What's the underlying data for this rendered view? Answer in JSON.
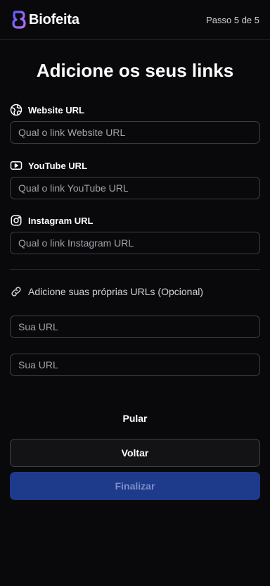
{
  "header": {
    "brand": "Biofeita",
    "step": "Passo 5 de 5"
  },
  "title": "Adicione os seus links",
  "fields": [
    {
      "label": "Website URL",
      "icon": "globe-icon",
      "placeholder": "Qual o link Website URL"
    },
    {
      "label": "YouTube URL",
      "icon": "youtube-icon",
      "placeholder": "Qual o link YouTube URL"
    },
    {
      "label": "Instagram URL",
      "icon": "instagram-icon",
      "placeholder": "Qual o link Instagram URL"
    }
  ],
  "custom": {
    "label": "Adicione suas próprias URLs (Opcional)",
    "icon": "link-icon",
    "inputs": [
      {
        "placeholder": "Sua URL"
      },
      {
        "placeholder": "Sua URL"
      }
    ]
  },
  "actions": {
    "skip": "Pular",
    "back": "Voltar",
    "finish": "Finalizar"
  },
  "colors": {
    "background": "#09090b",
    "border": "#3f3f46",
    "primary": "#1e3a8a",
    "logo_gradient_start": "#6d4aff",
    "logo_gradient_end": "#b86cff"
  }
}
